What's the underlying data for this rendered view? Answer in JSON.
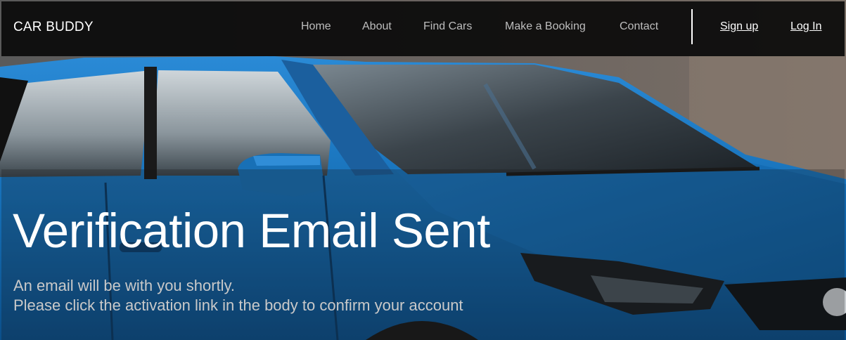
{
  "brand": "CAR BUDDY",
  "nav": {
    "items": [
      {
        "label": "Home"
      },
      {
        "label": "About"
      },
      {
        "label": "Find Cars"
      },
      {
        "label": "Make a Booking"
      },
      {
        "label": "Contact"
      }
    ],
    "signup_label": "Sign up",
    "login_label": "Log In"
  },
  "hero": {
    "title": "Verification Email Sent",
    "lines": [
      "An email will be with you shortly.",
      "Please click the activation link in the body to confirm your account"
    ]
  },
  "colors": {
    "navbar_bg": "#080808",
    "car_blue": "#1670b8",
    "text_white": "#ffffff",
    "nav_text": "#bdbdbd"
  }
}
